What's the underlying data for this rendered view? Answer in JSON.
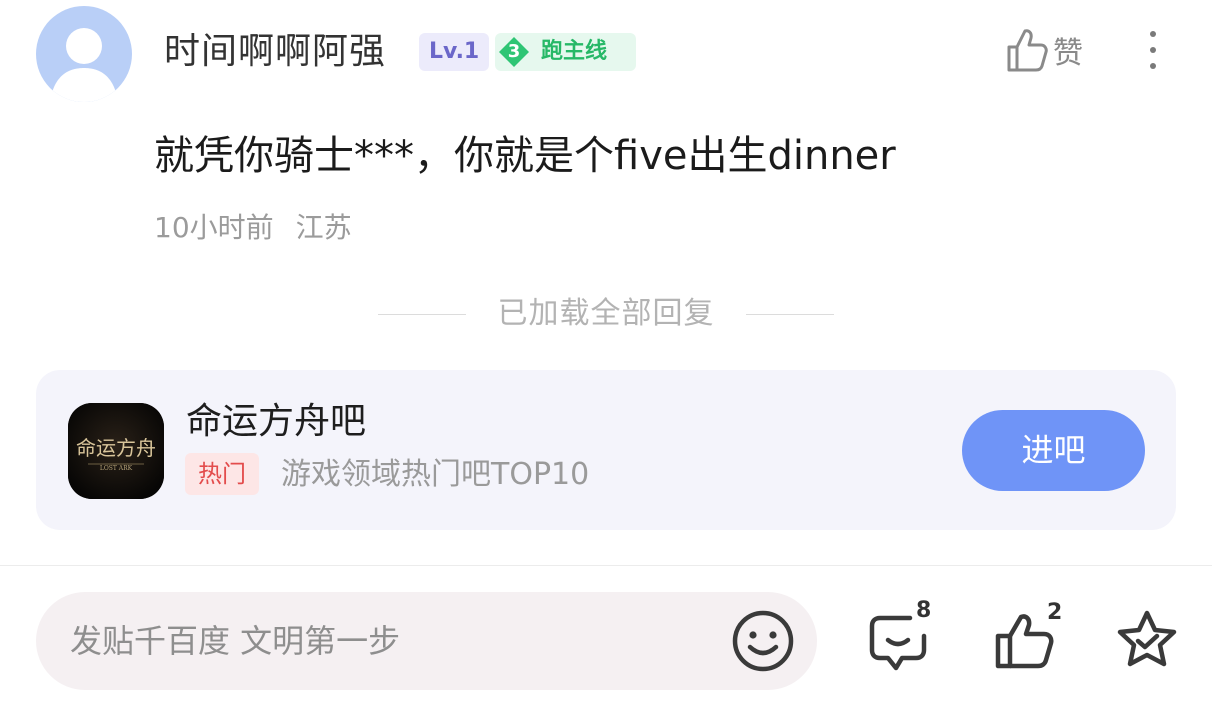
{
  "header": {
    "username": "时间啊啊阿强",
    "level_badge": "Lv.1",
    "tag_number": "3",
    "tag_text": "跑主线",
    "like_label": "赞"
  },
  "post": {
    "content": "就凭你骑士***，你就是个five出生dinner",
    "time": "10小时前",
    "location": "江苏"
  },
  "divider": {
    "text": "已加载全部回复"
  },
  "forum_card": {
    "name": "命运方舟吧",
    "hot_badge": "热门",
    "description": "游戏领域热门吧TOP10",
    "enter_button": "进吧",
    "logo_text": "命运方舟",
    "logo_subtext": "LOST ARK"
  },
  "bottom_bar": {
    "input_placeholder": "发贴千百度 文明第一步",
    "comment_count": "8",
    "like_count": "2"
  },
  "icons": {
    "avatar": "default-user-avatar",
    "like": "thumbs-up-icon",
    "more": "more-vertical-icon",
    "emoji": "smiley-icon",
    "comment": "comment-bubble-icon",
    "star": "star-favorite-icon"
  },
  "colors": {
    "accent_blue": "#6f94f7",
    "level_purple": "#6b67c9",
    "tag_green": "#27b867",
    "hot_red": "#e34c4c"
  }
}
